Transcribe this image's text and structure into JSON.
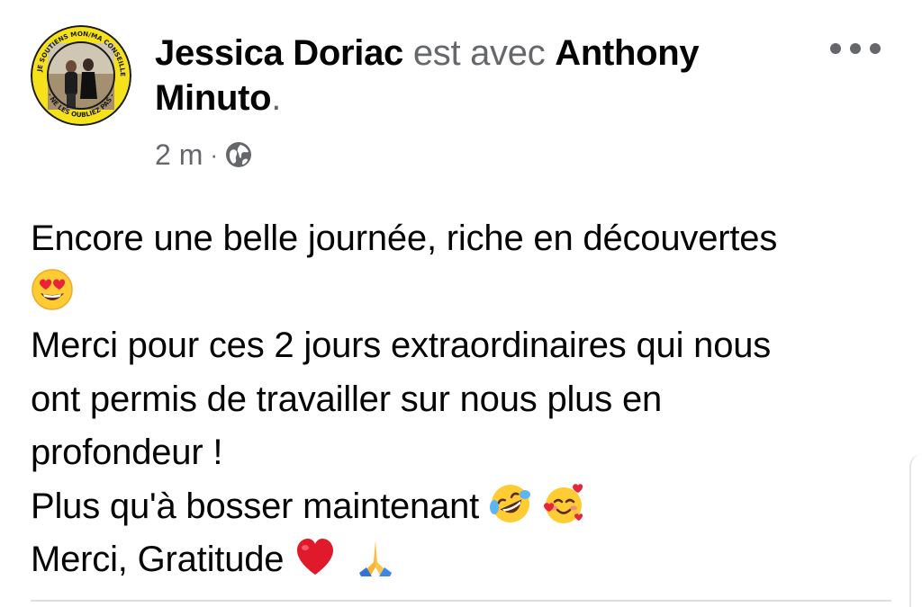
{
  "post": {
    "author_name": "Jessica Doriac",
    "with_text": "est avec",
    "tagged_name": "Anthony Minuto",
    "tagged_first": "Anthony",
    "tagged_last": "Minuto",
    "period": ".",
    "timestamp": "2 m",
    "separator": "·",
    "privacy_icon": "globe-icon",
    "avatar_ring_text": "JE SOUTIENS MON/MA CONSEILLER/ERE TEXAN · NE LES OUBLIEZ PAS",
    "menu_icon": "more-options-icon",
    "lines": [
      "Encore une belle journée, riche en découvertes",
      "",
      "Merci pour ces 2 jours extraordinaires qui nous",
      "ont permis de travailler sur nous plus en",
      "profondeur !",
      "Plus qu'à bosser maintenant",
      "Merci, Gratitude"
    ],
    "emojis": {
      "heart_eyes": "heart-eyes-emoji",
      "rofl": "rolling-laughing-emoji",
      "smiling_hearts": "smiling-hearts-emoji",
      "red_heart": "red-heart-emoji",
      "folded_hands": "folded-hands-emoji"
    }
  },
  "colors": {
    "primary_text": "#050505",
    "secondary_text": "#65676b",
    "avatar_ring": "#f5e21b",
    "heart": "#e0192b",
    "divider": "#dadde1"
  }
}
